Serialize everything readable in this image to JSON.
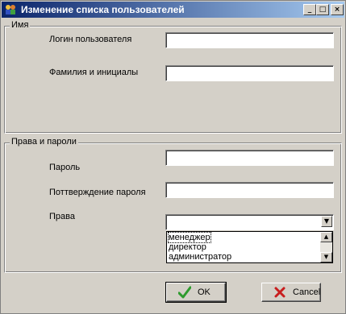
{
  "window": {
    "title": "Изменение списка пользователей",
    "minimize_glyph": "_",
    "maximize_glyph": "□",
    "close_glyph": "×"
  },
  "name_group": {
    "legend": "Имя",
    "login_label": "Логин пользователя",
    "login_value": "",
    "fullname_label": "Фамилия и инициалы",
    "fullname_value": ""
  },
  "rights_group": {
    "legend": "Права и пароли",
    "password_label": "Пароль",
    "password_value": "",
    "confirm_label": "Поттверждение пароля",
    "confirm_value": "",
    "rights_label": "Права",
    "rights_selected": "",
    "rights_options": [
      "менеджер",
      "директор",
      "администратор"
    ]
  },
  "buttons": {
    "ok_label": "OK",
    "cancel_label": "Cancel"
  },
  "colors": {
    "titlebar_start": "#0a246a",
    "titlebar_end": "#a6caf0",
    "face": "#d4d0c8",
    "ok_check": "#2e9b2e",
    "cancel_x": "#c81e1e"
  }
}
